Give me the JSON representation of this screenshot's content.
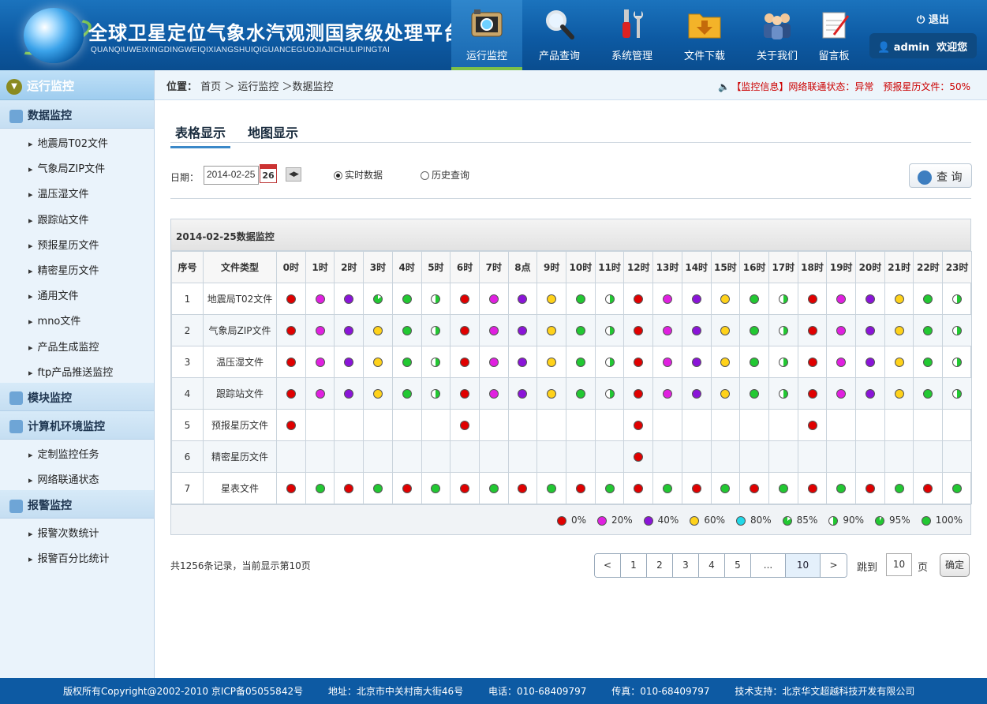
{
  "header": {
    "title": "全球卫星定位气象水汽观测国家级处理平台",
    "subtitle": "QUANQIUWEIXINGDINGWEIQIXIANGSHUIQIGUANCEGUOJIAJICHULIPINGTAI",
    "nav": [
      {
        "label": "运行监控",
        "icon": "monitor-icon",
        "active": true
      },
      {
        "label": "产品查询",
        "icon": "magnifier-icon"
      },
      {
        "label": "系统管理",
        "icon": "tools-icon"
      },
      {
        "label": "文件下载",
        "icon": "folder-download-icon"
      },
      {
        "label": "关于我们",
        "icon": "people-icon"
      },
      {
        "label": "留言板",
        "icon": "notepad-icon"
      }
    ],
    "logout_label": "退出",
    "user": "admin",
    "welcome": "欢迎您"
  },
  "sidebar": {
    "top_label": "运行监控",
    "groups": [
      {
        "label": "数据监控",
        "items": [
          "地震局T02文件",
          "气象局ZIP文件",
          "温压湿文件",
          "跟踪站文件",
          "预报星历文件",
          "精密星历文件",
          "通用文件",
          "mno文件",
          "产品生成监控",
          "ftp产品推送监控"
        ]
      },
      {
        "label": "模块监控",
        "items": []
      },
      {
        "label": "计算机环境监控",
        "items": [
          "定制监控任务",
          "网络联通状态"
        ]
      },
      {
        "label": "报警监控",
        "items": [
          "报警次数统计",
          "报警百分比统计"
        ]
      }
    ]
  },
  "breadcrumb": {
    "label": "位置：",
    "path": "首页 ＞ 运行监控 ＞数据监控"
  },
  "status": {
    "text": "【监控信息】网络联通状态：异常　预报星历文件：50%"
  },
  "tabs": [
    "表格显示",
    "地图显示"
  ],
  "filter": {
    "date_label": "日期：",
    "date_value": "2014-02-25",
    "calendar_day": "26",
    "radio_realtime": "实时数据",
    "radio_history": "历史查询",
    "query_label": "查 询"
  },
  "table": {
    "title": "2014-02-25数据监控",
    "col_index": "序号",
    "col_type": "文件类型",
    "hours": [
      "0时",
      "1时",
      "2时",
      "3时",
      "4时",
      "5时",
      "6时",
      "7时",
      "8点",
      "9时",
      "10时",
      "11时",
      "12时",
      "13时",
      "14时",
      "15时",
      "16时",
      "17时",
      "18时",
      "19时",
      "20时",
      "21时",
      "22时",
      "23时"
    ],
    "rows": [
      {
        "idx": "1",
        "type": "地震局T02文件",
        "status": [
          "0",
          "20",
          "40",
          "85",
          "100",
          "90",
          "0",
          "20",
          "40",
          "60",
          "100",
          "90",
          "0",
          "20",
          "40",
          "60",
          "100",
          "90",
          "0",
          "20",
          "40",
          "60",
          "100",
          "90"
        ]
      },
      {
        "idx": "2",
        "type": "气象局ZIP文件",
        "status": [
          "0",
          "20",
          "40",
          "60",
          "100",
          "90",
          "0",
          "20",
          "40",
          "60",
          "100",
          "90",
          "0",
          "20",
          "40",
          "60",
          "100",
          "90",
          "0",
          "20",
          "40",
          "60",
          "100",
          "90"
        ]
      },
      {
        "idx": "3",
        "type": "温压湿文件",
        "status": [
          "0",
          "20",
          "40",
          "60",
          "100",
          "90",
          "0",
          "20",
          "40",
          "60",
          "100",
          "90",
          "0",
          "20",
          "40",
          "60",
          "100",
          "90",
          "0",
          "20",
          "40",
          "60",
          "100",
          "90"
        ]
      },
      {
        "idx": "4",
        "type": "跟踪站文件",
        "status": [
          "0",
          "20",
          "40",
          "60",
          "100",
          "90",
          "0",
          "20",
          "40",
          "60",
          "100",
          "90",
          "0",
          "20",
          "40",
          "60",
          "100",
          "90",
          "0",
          "20",
          "40",
          "60",
          "100",
          "90"
        ]
      },
      {
        "idx": "5",
        "type": "预报星历文件",
        "status": [
          "0",
          "",
          "",
          "",
          "",
          "",
          "0",
          "",
          "",
          "",
          "",
          "",
          "0",
          "",
          "",
          "",
          "",
          "",
          "0",
          "",
          "",
          "",
          "",
          ""
        ]
      },
      {
        "idx": "6",
        "type": "精密星历文件",
        "status": [
          "",
          "",
          "",
          "",
          "",
          "",
          "",
          "",
          "",
          "",
          "",
          "",
          "0",
          "",
          "",
          "",
          "",
          "",
          "",
          "",
          "",
          "",
          "",
          ""
        ]
      },
      {
        "idx": "7",
        "type": "星表文件",
        "status": [
          "0",
          "100",
          "0",
          "100",
          "0",
          "100",
          "0",
          "100",
          "0",
          "100",
          "0",
          "100",
          "0",
          "100",
          "0",
          "100",
          "0",
          "100",
          "0",
          "100",
          "0",
          "100",
          "0",
          "100"
        ]
      }
    ],
    "legend": [
      {
        "key": "0",
        "label": "0%"
      },
      {
        "key": "20",
        "label": "20%"
      },
      {
        "key": "40",
        "label": "40%"
      },
      {
        "key": "60",
        "label": "60%"
      },
      {
        "key": "80",
        "label": "80%"
      },
      {
        "key": "85",
        "label": "85%"
      },
      {
        "key": "90",
        "label": "90%"
      },
      {
        "key": "95",
        "label": "95%"
      },
      {
        "key": "100",
        "label": "100%"
      }
    ],
    "colors": {
      "0": "#e00000",
      "20": "#e020e0",
      "40": "#8a14d8",
      "60": "#ffd21a",
      "80": "#20d8e8",
      "85": "#22c832",
      "90": "#22c832",
      "95": "#22c832",
      "100": "#22c832"
    }
  },
  "pagination": {
    "summary": "共1256条记录，当前显示第10页",
    "pages": [
      "<",
      "1",
      "2",
      "3",
      "4",
      "5",
      "...",
      "10",
      ">"
    ],
    "current": "10",
    "jump_label": "跳到",
    "jump_value": "10",
    "jump_unit": "页",
    "confirm": "确定"
  },
  "footer": {
    "copyright": "版权所有Copyright@2002-2010 京ICP备05055842号",
    "address": "地址：北京市中关村南大街46号",
    "phone": "电话：010-68409797",
    "fax": "传真：010-68409797",
    "support": "技术支持：北京华文超越科技开发有限公司"
  }
}
